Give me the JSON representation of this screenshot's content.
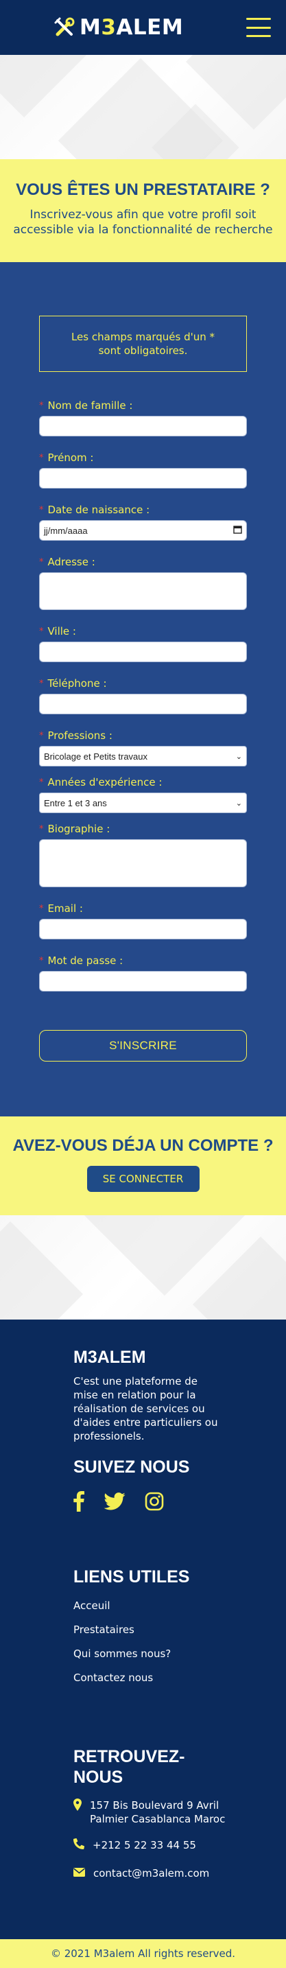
{
  "brand": {
    "name_prefix": "M",
    "name_accent": "3",
    "name_suffix": "ALEM"
  },
  "register": {
    "title": "VOUS ÊTES UN PRESTATAIRE ?",
    "subtitle": "Inscrivez-vous afin que votre profil soit accessible via la fonctionnalité de recherche",
    "notice": "Les champs marqués d'un * sont obligatoires.",
    "required_mark": "*",
    "fields": {
      "last_name": {
        "label": "Nom de famille :"
      },
      "first_name": {
        "label": "Prénom :"
      },
      "birth_date": {
        "label": "Date de naissance :",
        "placeholder": "jj/mm/aaaa"
      },
      "address": {
        "label": "Adresse :"
      },
      "city": {
        "label": "Ville :"
      },
      "phone": {
        "label": "Téléphone :"
      },
      "professions": {
        "label": "Professions :",
        "selected": "Bricolage et Petits travaux"
      },
      "experience": {
        "label": "Années d'expérience :",
        "selected": "Entre 1 et 3 ans"
      },
      "biography": {
        "label": "Biographie :"
      },
      "email": {
        "label": "Email :"
      },
      "password": {
        "label": "Mot de passe :"
      }
    },
    "submit_label": "S'INSCRIRE"
  },
  "account": {
    "title": "AVEZ-VOUS DÉJA UN COMPTE ?",
    "button_label": "SE CONNECTER"
  },
  "footer": {
    "about_title": "M3ALEM",
    "about_text": "C'est une plateforme de mise en relation pour la réalisation de services ou d'aides entre particuliers ou professionels.",
    "follow_title": "SUIVEZ NOUS",
    "social_icons": [
      "facebook-icon",
      "twitter-icon",
      "instagram-icon"
    ],
    "links_title": "LIENS UTILES",
    "links": [
      "Acceuil",
      "Prestataires",
      "Qui sommes nous?",
      "Contactez nous"
    ],
    "contact_title": "RETROUVEZ-NOUS",
    "address": "157 Bis Boulevard 9 Avril Palmier Casablanca Maroc",
    "phone": "+212 5 22 33 44 55",
    "email": "contact@m3alem.com",
    "copyright": "© 2021 M3alem All rights reserved."
  },
  "colors": {
    "navy": "#0b2a5c",
    "form_blue": "#25498a",
    "yellow": "#f4ee53",
    "pale_yellow": "#f8f67f",
    "title_blue": "#1f4b87",
    "required_red": "#e53935"
  }
}
